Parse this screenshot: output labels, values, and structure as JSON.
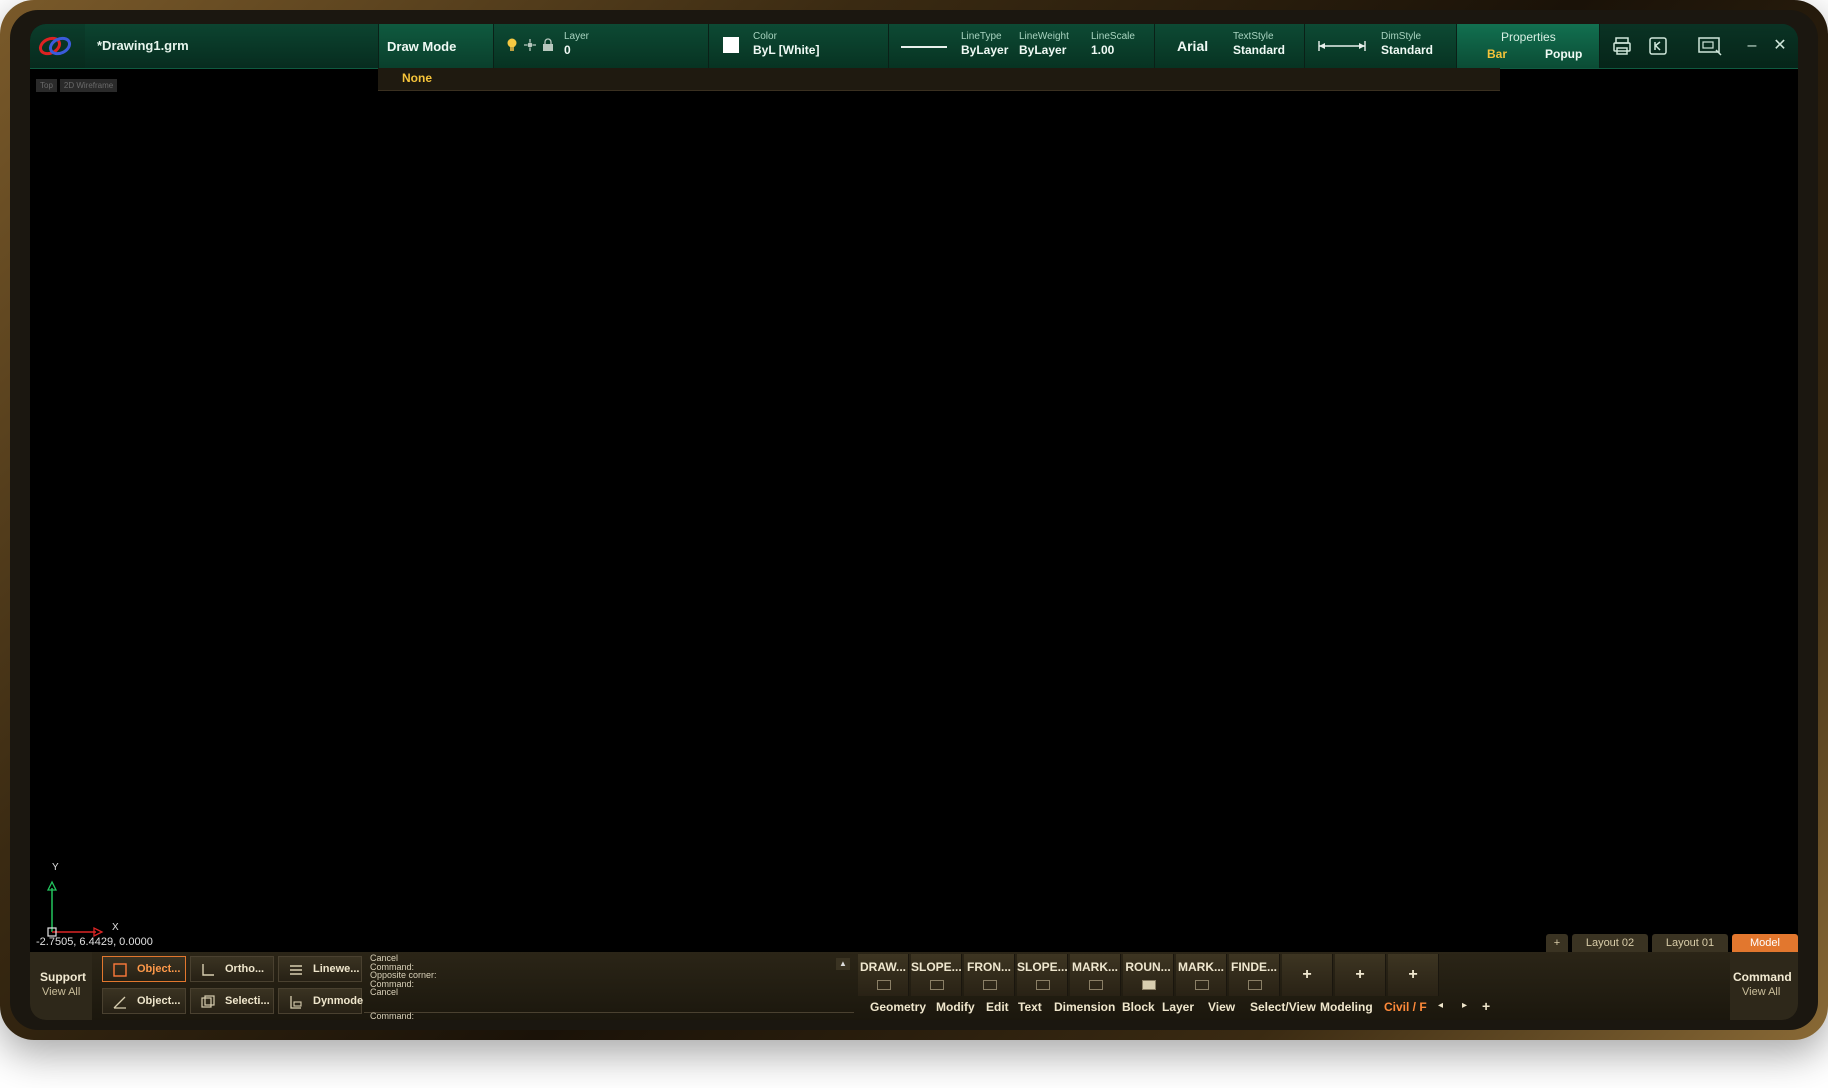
{
  "file": {
    "name": "*Drawing1.grm"
  },
  "toolbar": {
    "draw_mode": "Draw Mode",
    "layer_label": "Layer",
    "layer_value": "0",
    "color_label": "Color",
    "color_value": "ByL [White]",
    "linetype_label": "LineType",
    "linetype_value": "ByLayer",
    "lineweight_label": "LineWeight",
    "lineweight_value": "ByLayer",
    "linescale_label": "LineScale",
    "linescale_value": "1.00",
    "font_value": "Arial",
    "textstyle_label": "TextStyle",
    "textstyle_value": "Standard",
    "dimstyle_label": "DimStyle",
    "dimstyle_value": "Standard",
    "properties_label": "Properties",
    "properties_bar": "Bar",
    "properties_popup": "Popup"
  },
  "snap": {
    "value": "None"
  },
  "view": {
    "tags": [
      "Top",
      "2D Wireframe"
    ]
  },
  "axes": {
    "y": "Y",
    "x": "X"
  },
  "coords": "-2.7505, 6.4429, 0.0000",
  "layouts": [
    "Layout 02",
    "Layout 01",
    "Model"
  ],
  "layout_add": "+",
  "support": {
    "title": "Support",
    "sub": "View All"
  },
  "command": {
    "title": "Command",
    "sub": "View All"
  },
  "status_buttons": [
    {
      "label": "Object...",
      "active": true
    },
    {
      "label": "Ortho...",
      "active": false
    },
    {
      "label": "Linewe...",
      "active": false
    },
    {
      "label": "Object...",
      "active": false
    },
    {
      "label": "Selecti...",
      "active": false
    },
    {
      "label": "Dynmode",
      "active": false
    }
  ],
  "command_log": [
    "Cancel",
    "Command:",
    "Opposite corner:",
    "Command:",
    "Cancel",
    "Command:"
  ],
  "ribbon_buttons": [
    "DRAW...",
    "SLOPE...",
    "FRON...",
    "SLOPE...",
    "MARK...",
    "ROUN...",
    "MARK...",
    "FINDE...",
    "+",
    "+",
    "+"
  ],
  "ribbon_tabs": [
    "Geometry",
    "Modify",
    "Edit",
    "Text",
    "Dimension",
    "Block",
    "Layer",
    "View",
    "Select/View",
    "Modeling",
    "Civil / F"
  ],
  "ribbon_nav": {
    "prev": "◂",
    "next": "▸",
    "add": "+"
  },
  "colors": {
    "accent": "#e2772e",
    "topbar": "#0b3d2b",
    "highlight": "#f5c33a"
  }
}
